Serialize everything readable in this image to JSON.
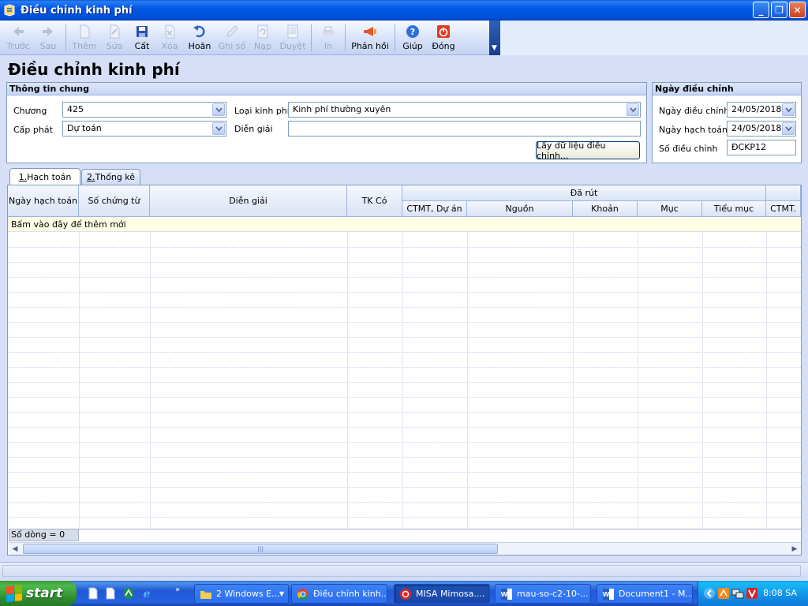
{
  "window": {
    "title": "Điều chỉnh kinh phí"
  },
  "toolbar": {
    "items": [
      {
        "label": "Trước",
        "icon": "arrow-left-icon",
        "enabled": false
      },
      {
        "label": "Sau",
        "icon": "arrow-right-icon",
        "enabled": false
      },
      {
        "label": "Thêm",
        "icon": "add-document-icon",
        "enabled": false
      },
      {
        "label": "Sửa",
        "icon": "edit-document-icon",
        "enabled": false
      },
      {
        "label": "Cất",
        "icon": "floppy-disk-icon",
        "enabled": true
      },
      {
        "label": "Xóa",
        "icon": "delete-document-icon",
        "enabled": false
      },
      {
        "label": "Hoãn",
        "icon": "undo-icon",
        "enabled": true
      },
      {
        "label": "Ghi sổ",
        "icon": "pencil-icon",
        "enabled": false
      },
      {
        "label": "Nạp",
        "icon": "reload-icon",
        "enabled": false
      },
      {
        "label": "Duyệt",
        "icon": "approve-icon",
        "enabled": false
      },
      {
        "label": "In",
        "icon": "printer-icon",
        "enabled": false
      },
      {
        "label": "Phản hồi",
        "icon": "megaphone-icon",
        "enabled": true
      },
      {
        "label": "Giúp",
        "icon": "help-icon",
        "enabled": true
      },
      {
        "label": "Đóng",
        "icon": "power-icon",
        "enabled": true
      }
    ]
  },
  "page": {
    "title": "Điều chỉnh kinh phí"
  },
  "general_info": {
    "heading": "Thông tin chung",
    "chuong_label": "Chương",
    "chuong_value": "425",
    "cap_phat_label": "Cấp phát",
    "cap_phat_value": "Dự toán",
    "loai_kinh_phi_label": "Loại kinh phí",
    "loai_kinh_phi_value": "Kinh phí thường xuyên",
    "dien_giai_label": "Diễn giải",
    "dien_giai_value": "",
    "fetch_button": "Lấy dữ liệu điều chỉnh..."
  },
  "adjust_date": {
    "heading": "Ngày điều chỉnh",
    "ngay_dieu_chinh_label": "Ngày điều chỉnh",
    "ngay_dieu_chinh_value": "24/05/2018",
    "ngay_hach_toan_label": "Ngày hạch toán",
    "ngay_hach_toan_value": "24/05/2018",
    "so_dieu_chinh_label": "Số điều chỉnh",
    "so_dieu_chinh_value": "ĐCKP12"
  },
  "tabs": [
    {
      "key": "1.",
      "label": " Hạch toán",
      "active": true
    },
    {
      "key": "2.",
      "label": " Thống kê",
      "active": false
    }
  ],
  "grid": {
    "headers": {
      "ngay_hach_toan": "Ngày hạch toán",
      "so_chung_tu": "Số chứng từ",
      "dien_giai": "Diễn giải",
      "tk_co": "TK Có",
      "da_rut": "Đã rút",
      "ctmt_du_an": "CTMT, Dự án",
      "nguon": "Nguồn",
      "khoan": "Khoản",
      "muc": "Mục",
      "tieu_muc": "Tiểu mục",
      "ctmt": "CTMT."
    },
    "add_row_text": "Bấm vào đây để thêm mới",
    "row_count": "Số dòng = 0"
  },
  "taskbar": {
    "start_label": "start",
    "tasks": [
      {
        "label": "2 Windows E...",
        "icon": "folder-icon"
      },
      {
        "label": "Điều chỉnh kinh...",
        "icon": "chrome-icon"
      },
      {
        "label": "MISA Mimosa....",
        "icon": "misa-icon"
      },
      {
        "label": "mau-so-c2-10-...",
        "icon": "word-icon"
      },
      {
        "label": "Document1 - M...",
        "icon": "word-icon"
      }
    ],
    "clock": "8:08 SA"
  }
}
